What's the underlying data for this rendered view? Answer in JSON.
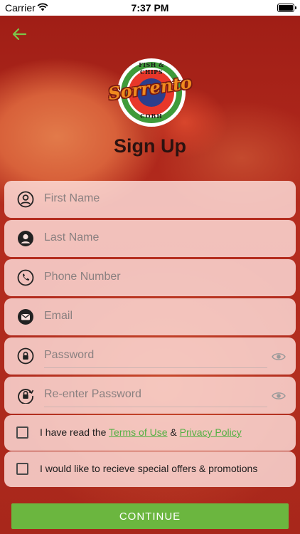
{
  "status_bar": {
    "carrier": "Carrier",
    "time": "7:37 PM"
  },
  "logo": {
    "top_text": "FISH & CHIPS",
    "brand": "Sorrento",
    "bottom_text": "COBH"
  },
  "page": {
    "title": "Sign Up"
  },
  "form": {
    "first_name": {
      "placeholder": "First Name",
      "value": ""
    },
    "last_name": {
      "placeholder": "Last Name",
      "value": ""
    },
    "phone": {
      "placeholder": "Phone Number",
      "value": ""
    },
    "email": {
      "placeholder": "Email",
      "value": ""
    },
    "password": {
      "placeholder": "Password",
      "value": ""
    },
    "confirm_password": {
      "placeholder": "Re-enter Password",
      "value": ""
    }
  },
  "terms": {
    "prefix": "I have read the ",
    "terms_link": "Terms of Use",
    "joiner": " & ",
    "privacy_link": "Privacy Policy",
    "checked": false
  },
  "offers": {
    "label": "I would like to recieve special offers & promotions",
    "checked": false
  },
  "actions": {
    "continue_label": "CONTINUE"
  },
  "colors": {
    "accent_green": "#6bb63f",
    "link_green": "#55b044",
    "background_red": "#b0241a"
  },
  "icons": [
    "back-arrow-icon",
    "user-outline-icon",
    "user-filled-icon",
    "phone-icon",
    "email-icon",
    "lock-icon",
    "lock-reset-icon",
    "eye-icon"
  ]
}
